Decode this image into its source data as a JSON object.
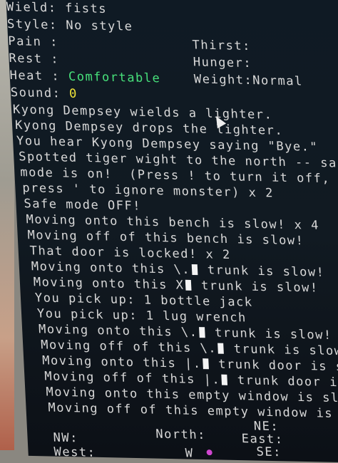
{
  "status": {
    "wield_label": "Wield:",
    "wield_value": "fists",
    "style_label": "Style:",
    "style_value": "No style",
    "pain_label": "Pain :",
    "rest_label": "Rest :",
    "heat_label": "Heat :",
    "heat_value": "Comfortable",
    "sound_label": "Sound:",
    "sound_value": "0",
    "thirst_label": "Thirst:",
    "hunger_label": "Hunger:",
    "weight_label": "Weight:",
    "weight_value": "Normal"
  },
  "messages": {
    "m1": "Kyong Dempsey wields a lighter.",
    "m2": "Kyong Dempsey drops the lighter.",
    "m3": "You hear Kyong Dempsey saying \"Bye.\"",
    "m4": "Spotted tiger wight to the north -- safe",
    "m5": "mode is on!  (Press ! to turn it off,",
    "m6": "press ' to ignore monster) x 2",
    "m7": "Safe mode OFF!",
    "m8": "Moving onto this bench is slow! x 4",
    "m9": "Moving off of this bench is slow!",
    "m10": "That door is locked! x 2",
    "m11a": "Moving onto this \\.",
    "m11b": " trunk is slow!",
    "m12a": "Moving onto this X",
    "m12b": " trunk is slow!",
    "m13": "You pick up: 1 bottle jack",
    "m14": "You pick up: 1 lug wrench",
    "m15a": "Moving onto this \\.",
    "m15b": " trunk is slow!",
    "m16a": "Moving off of this \\.",
    "m16b": " trunk is slow!",
    "m17a": "Moving onto this |.",
    "m17b": " trunk door is slow!",
    "m18a": "Moving off of this |.",
    "m18b": " trunk door is slow!",
    "m19": "Moving onto this empty window is slow!",
    "m20": "Moving off of this empty window is slow!"
  },
  "compass": {
    "ne": "NE:",
    "nw": "NW:",
    "north": "North:",
    "east": "East:",
    "west": "West:",
    "se": "SE:",
    "west_value": "W"
  },
  "colors": {
    "heat": "#47e07a",
    "sound": "#f0e43a",
    "text": "#d8d8d8"
  }
}
